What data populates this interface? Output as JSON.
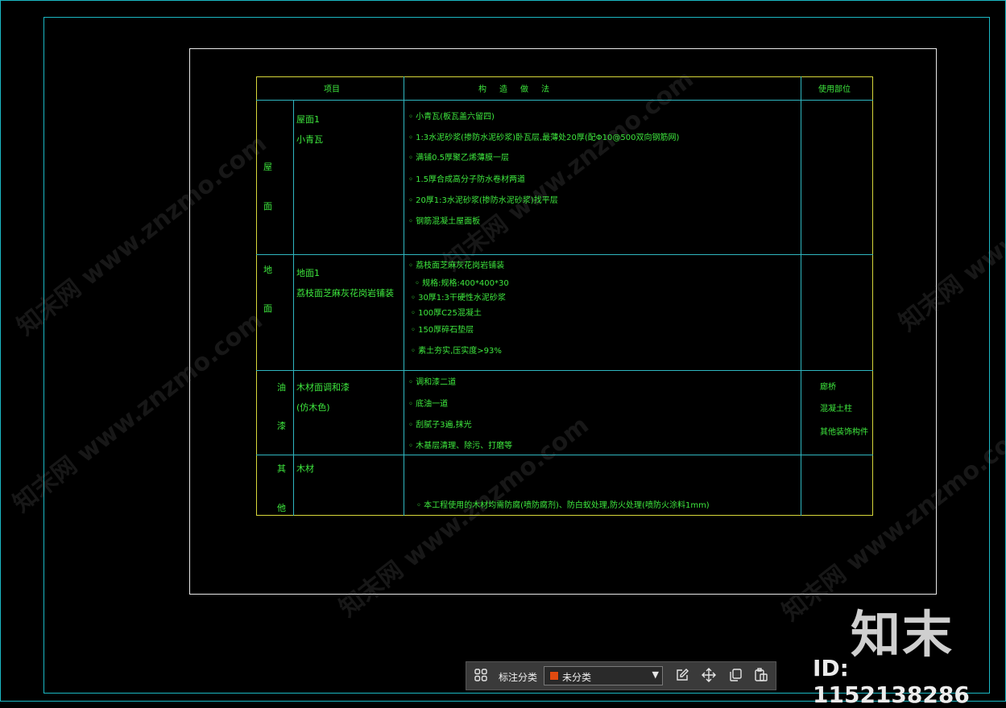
{
  "table": {
    "headers": [
      "项目",
      "构　造　做　法",
      "使用部位"
    ],
    "rows": [
      {
        "category": [
          "屋",
          "面"
        ],
        "name": [
          "屋面1",
          "小青瓦"
        ],
        "steps": [
          "小青瓦(板瓦盖六留四)",
          "1:3水泥砂浆(掺防水泥砂浆)卧瓦层,最薄处20厚(配Φ10@500双向钢筋网)",
          "满铺0.5厚聚乙烯薄膜一层",
          "1.5厚合成高分子防水卷材两道",
          "20厚1:3水泥砂浆(掺防水泥砂浆)找平层",
          "钢筋混凝土屋面板"
        ],
        "usage": []
      },
      {
        "category": [
          "地",
          "面"
        ],
        "name": [
          "地面1",
          "荔枝面芝麻灰花岗岩铺装"
        ],
        "steps": [
          "荔枝面芝麻灰花岗岩铺装",
          "规格:规格:400*400*30",
          "30厚1:3干硬性水泥砂浆",
          "100厚C25混凝土",
          "150厚碎石垫层",
          "素土夯实,压实度>93%"
        ],
        "usage": []
      },
      {
        "category": [
          "油",
          "漆"
        ],
        "name": [
          "木材面调和漆",
          "(仿木色)"
        ],
        "steps": [
          "调和漆二道",
          "底油一道",
          "刮腻子3遍,抹光",
          "木基层清理、除污、打磨等"
        ],
        "usage": [
          "廊桥",
          "混凝土柱",
          "其他装饰构件"
        ]
      },
      {
        "category": [
          "其",
          "他"
        ],
        "name": [
          "木材"
        ],
        "steps": [
          "本工程使用的木材均需防腐(喷防腐剂)、防白蚁处理,防火处理(喷防火涂料1mm)"
        ],
        "usage": []
      }
    ]
  },
  "watermark": {
    "text": "知末网 www.znzmo.com"
  },
  "brand": {
    "logo_text": "知末",
    "id_text": "ID: 1152138286"
  },
  "toolbar": {
    "label": "标注分类",
    "select_value": "未分类",
    "swatch_color": "#e04a10",
    "icons": [
      "grid-icon",
      "edit-icon",
      "move-icon",
      "copy-icon",
      "paste-icon"
    ]
  },
  "colors": {
    "frame": "#1bb8c4",
    "table_border": "#d8d83a",
    "table_divider": "#2fb6c0",
    "text": "#3ee83e"
  }
}
